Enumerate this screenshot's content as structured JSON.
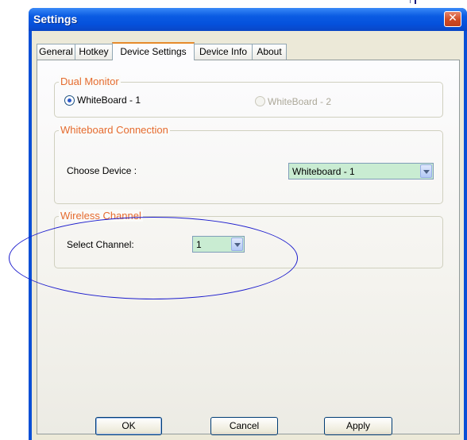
{
  "window": {
    "title": "Settings",
    "close_glyph": "✕"
  },
  "tabs": [
    {
      "label": "General",
      "active": false
    },
    {
      "label": "Hotkey",
      "active": false
    },
    {
      "label": "Device Settings",
      "active": true
    },
    {
      "label": "Device Info",
      "active": false
    },
    {
      "label": "About",
      "active": false
    }
  ],
  "dual_monitor": {
    "legend": "Dual Monitor",
    "option1": {
      "label": "WhiteBoard - 1",
      "checked": true
    },
    "option2": {
      "label": "WhiteBoard - 2",
      "checked": false,
      "disabled": true
    }
  },
  "connection": {
    "legend": "Whiteboard Connection",
    "choose_label": "Choose Device :",
    "device_value": "Whiteboard - 1"
  },
  "wireless": {
    "legend": "Wireless Channel",
    "select_label": "Select Channel:",
    "channel_value": "1"
  },
  "buttons": {
    "ok": "OK",
    "cancel": "Cancel",
    "apply": "Apply"
  },
  "colors": {
    "title_bar": "#0b5ce3",
    "legend_text": "#e56b2f",
    "combo_background": "#c9ecd2",
    "annotation_ellipse": "#1c1ccd"
  }
}
